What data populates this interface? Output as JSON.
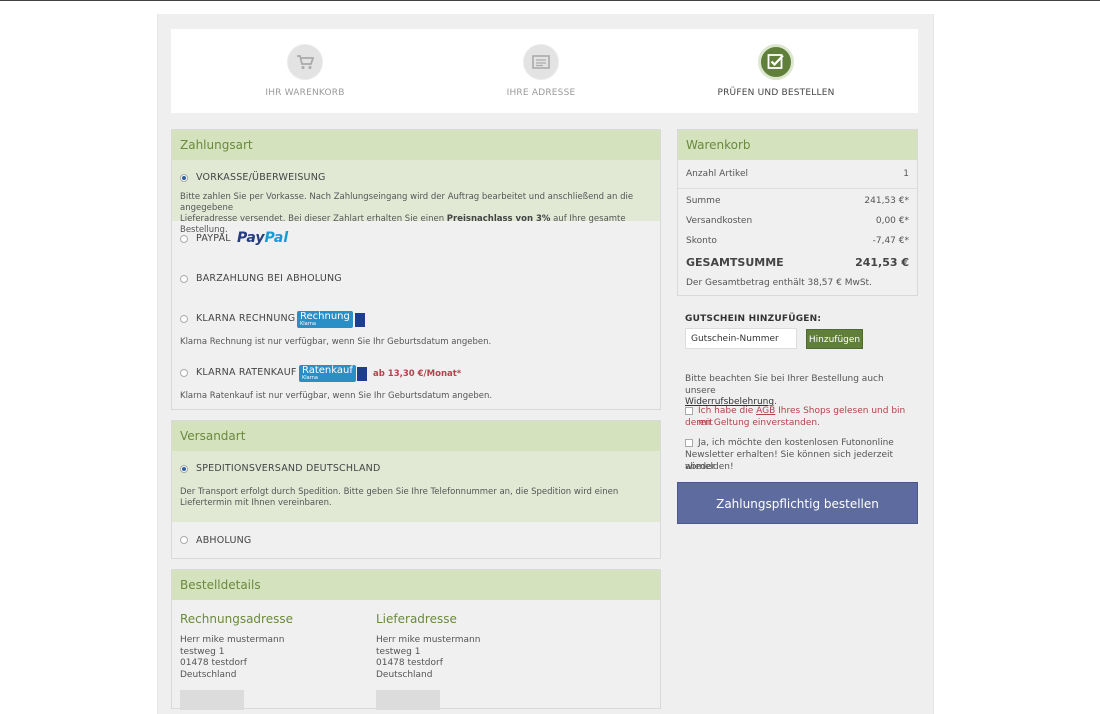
{
  "steps": [
    {
      "label": "IHR WARENKORB",
      "icon": "cart-icon"
    },
    {
      "label": "IHRE ADRESSE",
      "icon": "address-card-icon"
    },
    {
      "label": "PRÜFEN UND BESTELLEN",
      "icon": "check-icon",
      "active": true
    }
  ],
  "payment": {
    "title": "Zahlungsart",
    "vorkasse": {
      "label": "VORKASSE/ÜBERWEISUNG",
      "desc1": "Bitte zahlen Sie per Vorkasse. Nach Zahlungseingang wird der Auftrag bearbeitet und anschließend an die angegebene",
      "desc2a": "Lieferadresse versendet. Bei dieser Zahlart erhalten Sie einen ",
      "desc2b": "Preisnachlass von 3%",
      "desc2c": " auf Ihre gesamte Bestellung."
    },
    "paypal": {
      "label": "PAYPAL",
      "logo_a": "Pay",
      "logo_b": "Pal"
    },
    "barzahlung": {
      "label": "BARZAHLUNG BEI ABHOLUNG"
    },
    "klarna_rechnung": {
      "label": "KLARNA RECHNUNG",
      "badge": "Rechnung",
      "badge_sub": "Klarna",
      "desc": "Klarna Rechnung ist nur verfügbar, wenn Sie Ihr Geburtsdatum angeben."
    },
    "klarna_raten": {
      "label": "KLARNA RATENKAUF",
      "badge": "Ratenkauf",
      "badge_sub": "Klarna",
      "price": "ab 13,30 €/Monat*",
      "desc": "Klarna Ratenkauf ist nur verfügbar, wenn Sie Ihr Geburtsdatum angeben."
    }
  },
  "shipping": {
    "title": "Versandart",
    "spedition": {
      "label": "SPEDITIONSVERSAND DEUTSCHLAND",
      "desc1": "Der Transport erfolgt durch Spedition. Bitte geben Sie Ihre Telefonnummer an, die Spedition wird einen",
      "desc2": "Liefertermin mit Ihnen vereinbaren."
    },
    "abholung": {
      "label": "ABHOLUNG"
    }
  },
  "details": {
    "title": "Bestelldetails",
    "billing": {
      "title": "Rechnungsadresse",
      "name": "Herr mike mustermann",
      "street": "testweg 1",
      "city": "01478 testdorf",
      "country": "Deutschland"
    },
    "delivery": {
      "title": "Lieferadresse",
      "name": "Herr mike mustermann",
      "street": "testweg 1",
      "city": "01478 testdorf",
      "country": "Deutschland"
    }
  },
  "cart": {
    "title": "Warenkorb",
    "count_label": "Anzahl Artikel",
    "count": "1",
    "sum_label": "Summe",
    "sum": "241,53 €*",
    "shipping_label": "Versandkosten",
    "shipping": "0,00 €*",
    "skonto_label": "Skonto",
    "skonto": "-7,47 €*",
    "total_label": "GESAMTSUMME",
    "total": "241,53 €",
    "vat_note": "Der Gesamtbetrag enthält 38,57 € MwSt."
  },
  "voucher": {
    "label": "GUTSCHEIN HINZUFÜGEN:",
    "placeholder": "Gutschein-Nummer",
    "button": "Hinzufügen"
  },
  "legal": {
    "note_a": "Bitte beachten Sie bei Ihrer Bestellung auch unsere",
    "note_link": "Widerrufsbelehrung",
    "note_b": ".",
    "agb_a": "Ich habe die ",
    "agb_link": "AGB",
    "agb_b": " Ihres Shops gelesen und bin mit",
    "agb_c": "deren Geltung einverstanden.",
    "newsletter_1": "Ja, ich möchte den kostenlosen Futononline",
    "newsletter_2": "Newsletter erhalten! Sie können sich jederzeit wieder",
    "newsletter_3": "abmelden!"
  },
  "order_button": "Zahlungspflichtig bestellen",
  "colors": {
    "accent_green": "#5f7f3a",
    "header_green": "#d4e2bd",
    "order_blue": "#5d6b9f",
    "alert_red": "#b5424a"
  }
}
